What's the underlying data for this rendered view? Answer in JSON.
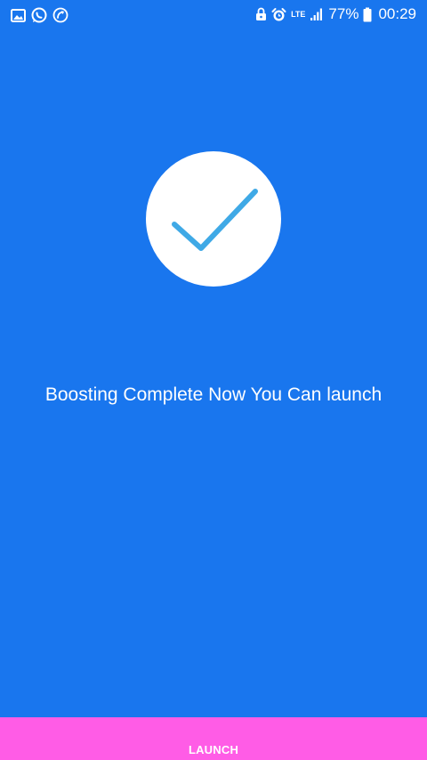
{
  "status_bar": {
    "left_icons": [
      "gallery-icon",
      "whatsapp-icon",
      "phone-call-icon"
    ],
    "right_icons": [
      "lock-icon",
      "alarm-icon",
      "lte-icon",
      "signal-icon",
      "battery-icon"
    ],
    "network": "LTE",
    "battery_percent": "77%",
    "time": "00:29"
  },
  "main": {
    "status_icon": "check-circle-icon",
    "message": "Boosting Complete Now You Can launch"
  },
  "footer": {
    "launch_label": "LAUNCH"
  },
  "colors": {
    "background": "#1976EE",
    "check_stroke": "#3FA9E6",
    "button_background": "#FF5CE6",
    "text": "#FFFFFF"
  }
}
